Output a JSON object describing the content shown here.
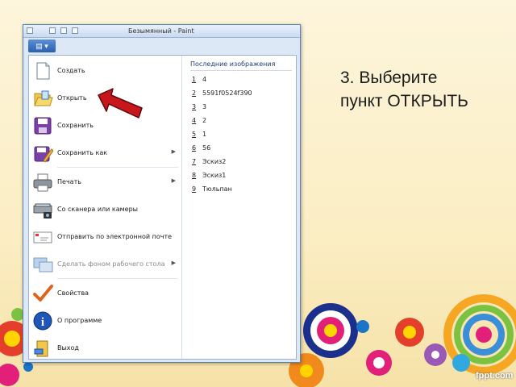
{
  "window": {
    "title": "Безымянный - Paint",
    "menu_button": "▤ ▾"
  },
  "menu": {
    "items": [
      {
        "label": "Создать",
        "icon": "new-file-icon",
        "submenu": false
      },
      {
        "label": "Открыть",
        "icon": "open-folder-icon",
        "submenu": false
      },
      {
        "label": "Сохранить",
        "icon": "save-disk-icon",
        "submenu": false
      },
      {
        "label": "Сохранить как",
        "icon": "save-as-icon",
        "submenu": true
      },
      {
        "label": "Печать",
        "icon": "printer-icon",
        "submenu": true
      },
      {
        "label": "Со сканера или камеры",
        "icon": "scanner-icon",
        "submenu": false
      },
      {
        "label": "Отправить по электронной почте",
        "icon": "email-icon",
        "submenu": false
      },
      {
        "label": "Сделать фоном рабочего стола",
        "icon": "desktop-icon",
        "submenu": true
      },
      {
        "label": "Свойства",
        "icon": "checkmark-icon",
        "submenu": false
      },
      {
        "label": "О программе",
        "icon": "info-icon",
        "submenu": false
      },
      {
        "label": "Выход",
        "icon": "exit-icon",
        "submenu": false
      }
    ],
    "recent_title": "Последние изображения",
    "recent": [
      {
        "num": "1",
        "name": "4"
      },
      {
        "num": "2",
        "name": "5591f0524f390"
      },
      {
        "num": "3",
        "name": "3"
      },
      {
        "num": "4",
        "name": "2"
      },
      {
        "num": "5",
        "name": "1"
      },
      {
        "num": "6",
        "name": "56"
      },
      {
        "num": "7",
        "name": "Эскиз2"
      },
      {
        "num": "8",
        "name": "Эскиз1"
      },
      {
        "num": "9",
        "name": "Тюльпан"
      }
    ]
  },
  "caption": {
    "line1": "3. Выберите",
    "line2": "пункт ОТКРЫТЬ"
  },
  "logo": "fppt.com",
  "colors": {
    "pointer_arrow": "#c8161d",
    "menu_accent": "#1e3e78"
  }
}
